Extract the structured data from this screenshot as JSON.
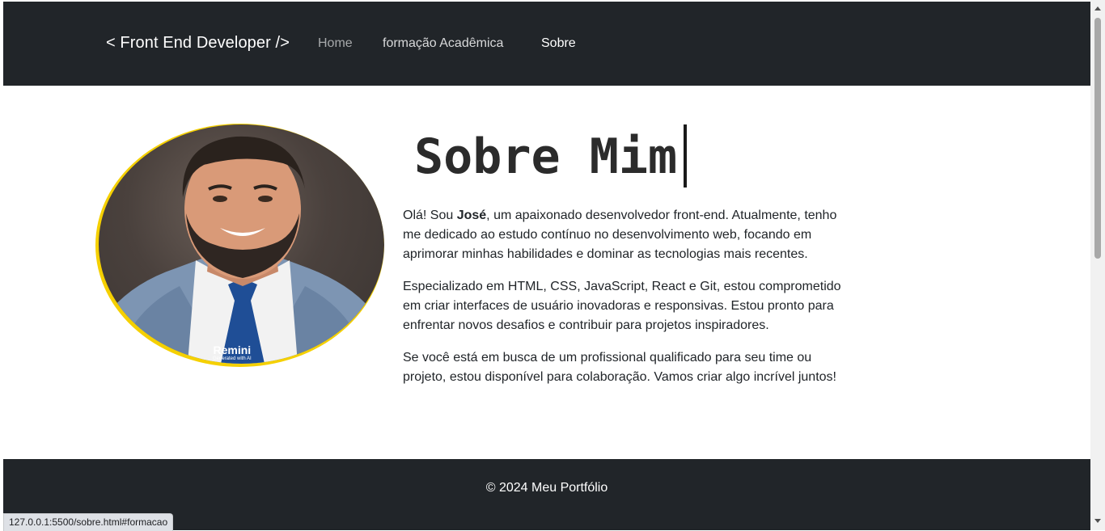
{
  "nav": {
    "brand": "< Front End Developer />",
    "links": [
      {
        "label": "Home"
      },
      {
        "label": "formação Acadêmica"
      },
      {
        "label": "Sobre"
      }
    ]
  },
  "profile": {
    "photo_watermark": "Remini",
    "photo_watermark_sub": "Generated with AI"
  },
  "main": {
    "title": "Sobre Mim",
    "p1": {
      "pre": "Olá! Sou ",
      "name": "José",
      "post": ", um apaixonado desenvolvedor front-end. Atualmente, tenho me dedicado ao estudo contínuo no desenvolvimento web, focando em aprimorar minhas habilidades e dominar as tecnologias mais recentes."
    },
    "p2": "Especializado em HTML, CSS, JavaScript, React e Git, estou comprometido em criar interfaces de usuário inovadoras e responsivas. Estou pronto para enfrentar novos desafios e contribuir para projetos inspiradores.",
    "p3": "Se você está em busca de um profissional qualificado para seu time ou projeto, estou disponível para colaboração. Vamos criar algo incrível juntos!"
  },
  "footer": {
    "text": "© 2024 Meu Portfólio"
  },
  "status_bar": {
    "url": "127.0.0.1:5500/sobre.html#formacao"
  },
  "colors": {
    "navbar": "#212529",
    "photo_ring": "#f5d000",
    "footer": "#212529"
  }
}
